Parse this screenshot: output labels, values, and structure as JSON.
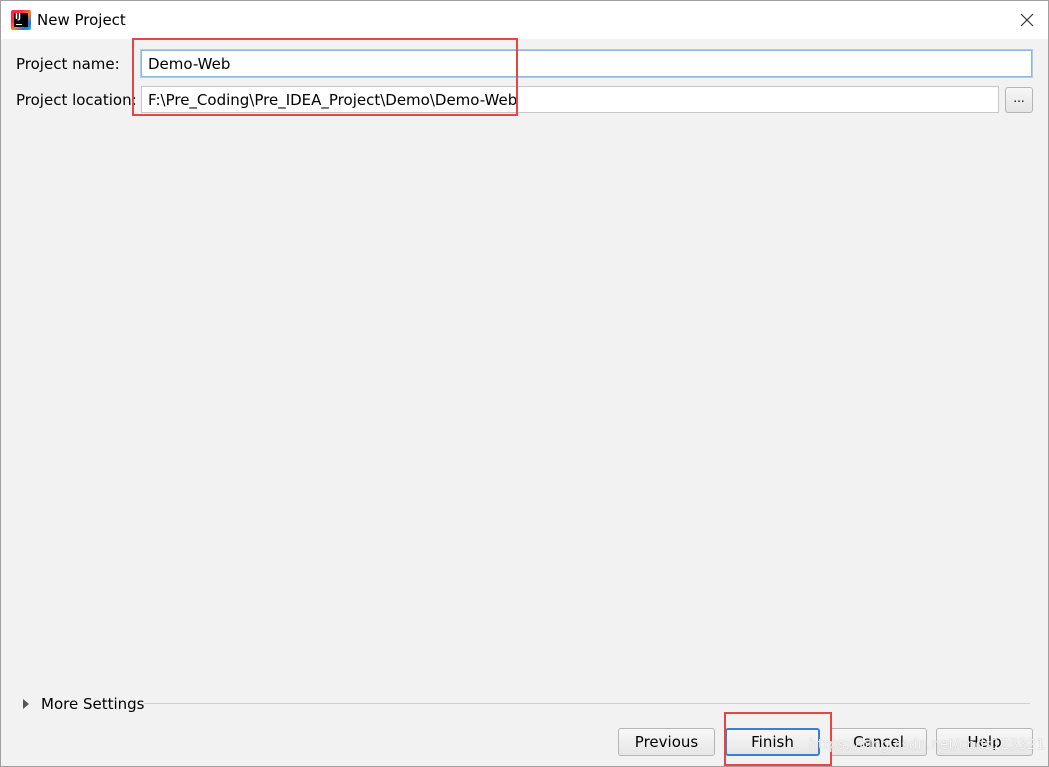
{
  "window": {
    "title": "New Project"
  },
  "form": {
    "name_label": "Project name:",
    "name_value": "Demo-Web",
    "location_label": "Project location:",
    "location_value": "F:\\Pre_Coding\\Pre_IDEA_Project\\Demo\\Demo-Web",
    "browse_label": "..."
  },
  "more_settings": {
    "label": "More Settings"
  },
  "buttons": {
    "previous": "Previous",
    "finish": "Finish",
    "cancel": "Cancel",
    "help": "Help"
  },
  "watermark": "https://blog.csdn.net/cnds123321",
  "colors": {
    "highlight": "#e64545",
    "focus": "#8cb8e0",
    "default_button_border": "#3a7fd4"
  },
  "icons": {
    "app": "intellij-idea-icon",
    "close": "close-icon",
    "expand": "triangle-right-icon"
  }
}
